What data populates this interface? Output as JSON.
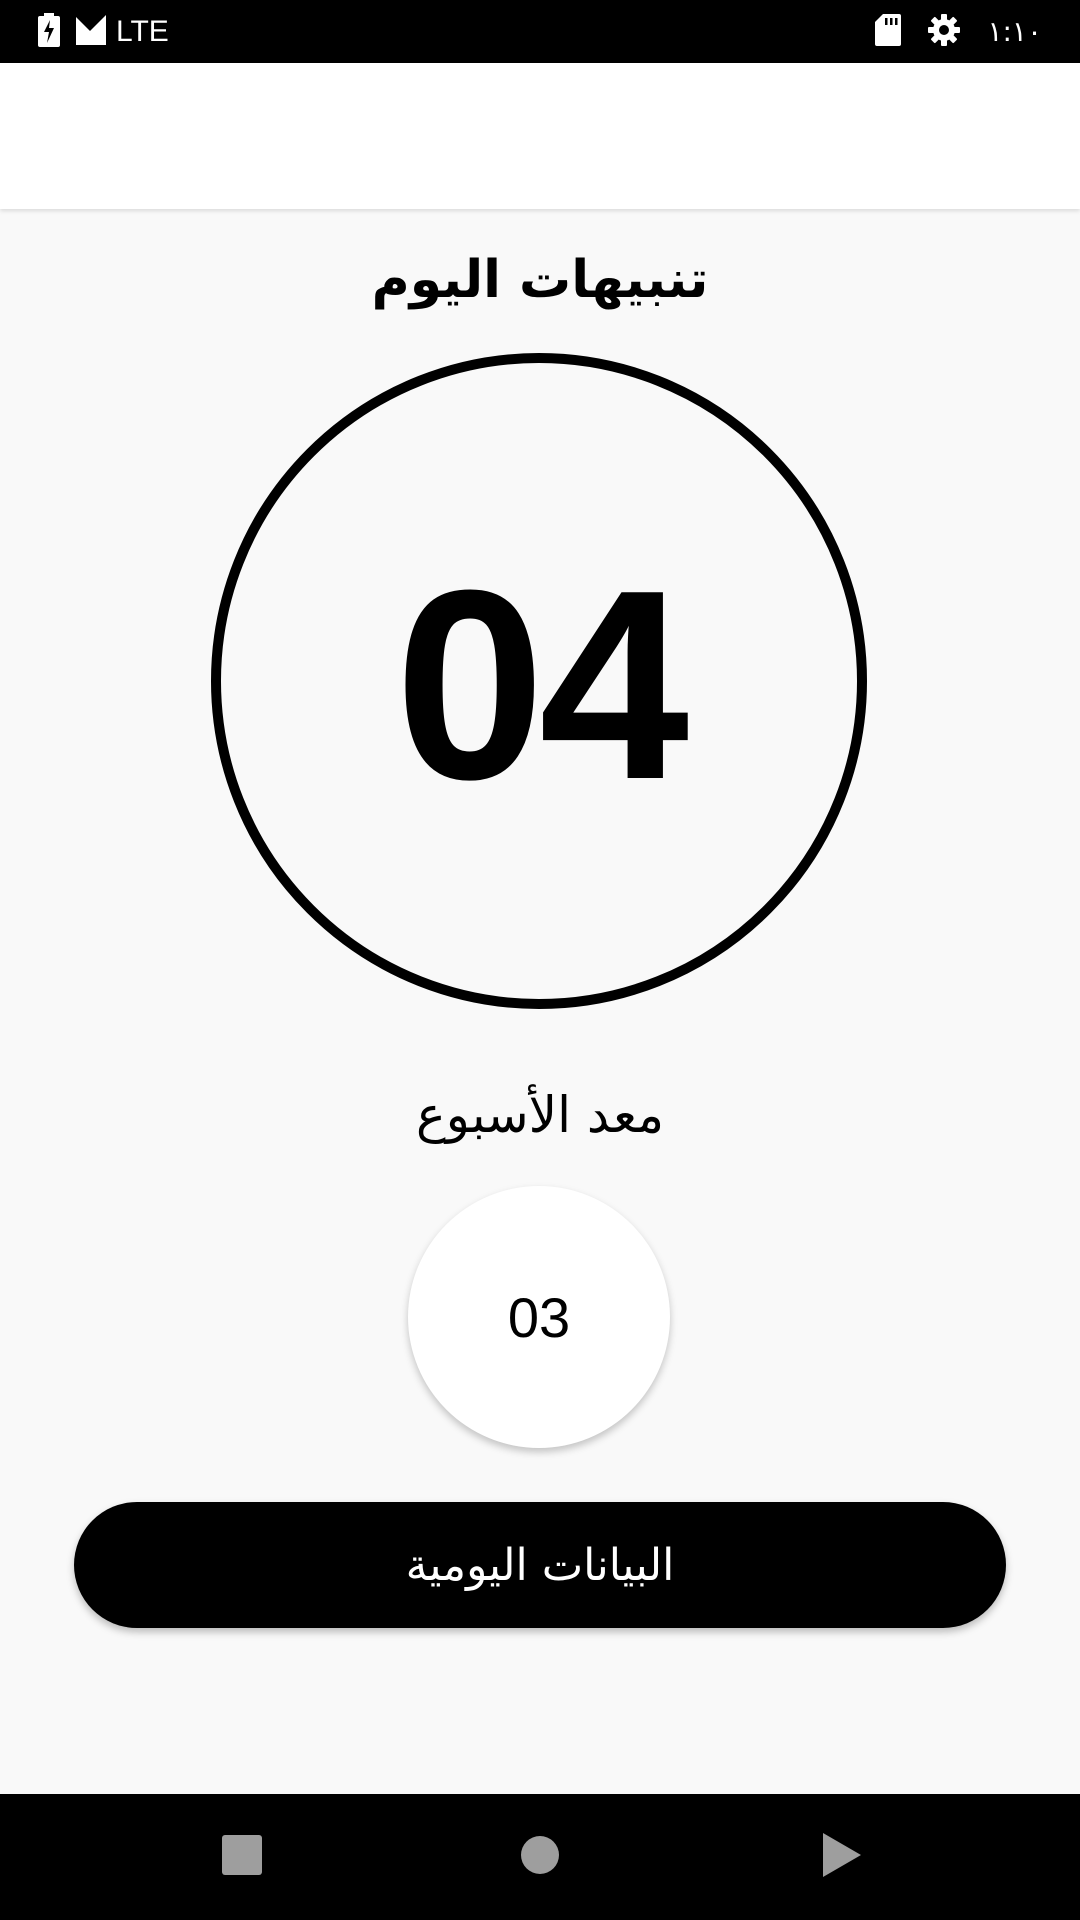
{
  "status_bar": {
    "network_type": "LTE",
    "time": "١:١٠",
    "icons": [
      "battery-charging-icon",
      "signal-icon",
      "sd-card-icon",
      "settings-icon"
    ]
  },
  "main": {
    "title": "تنبيهات اليوم",
    "today_count": "04",
    "weekly_label": "معد الأسبوع",
    "weekly_count": "03",
    "daily_data_button": "البيانات اليومية"
  },
  "nav_bar": {
    "icons": [
      "recents-square-icon",
      "home-circle-icon",
      "back-triangle-icon"
    ]
  },
  "colors": {
    "background": "#f9f9f9",
    "accent": "#000000",
    "surface": "#ffffff"
  }
}
